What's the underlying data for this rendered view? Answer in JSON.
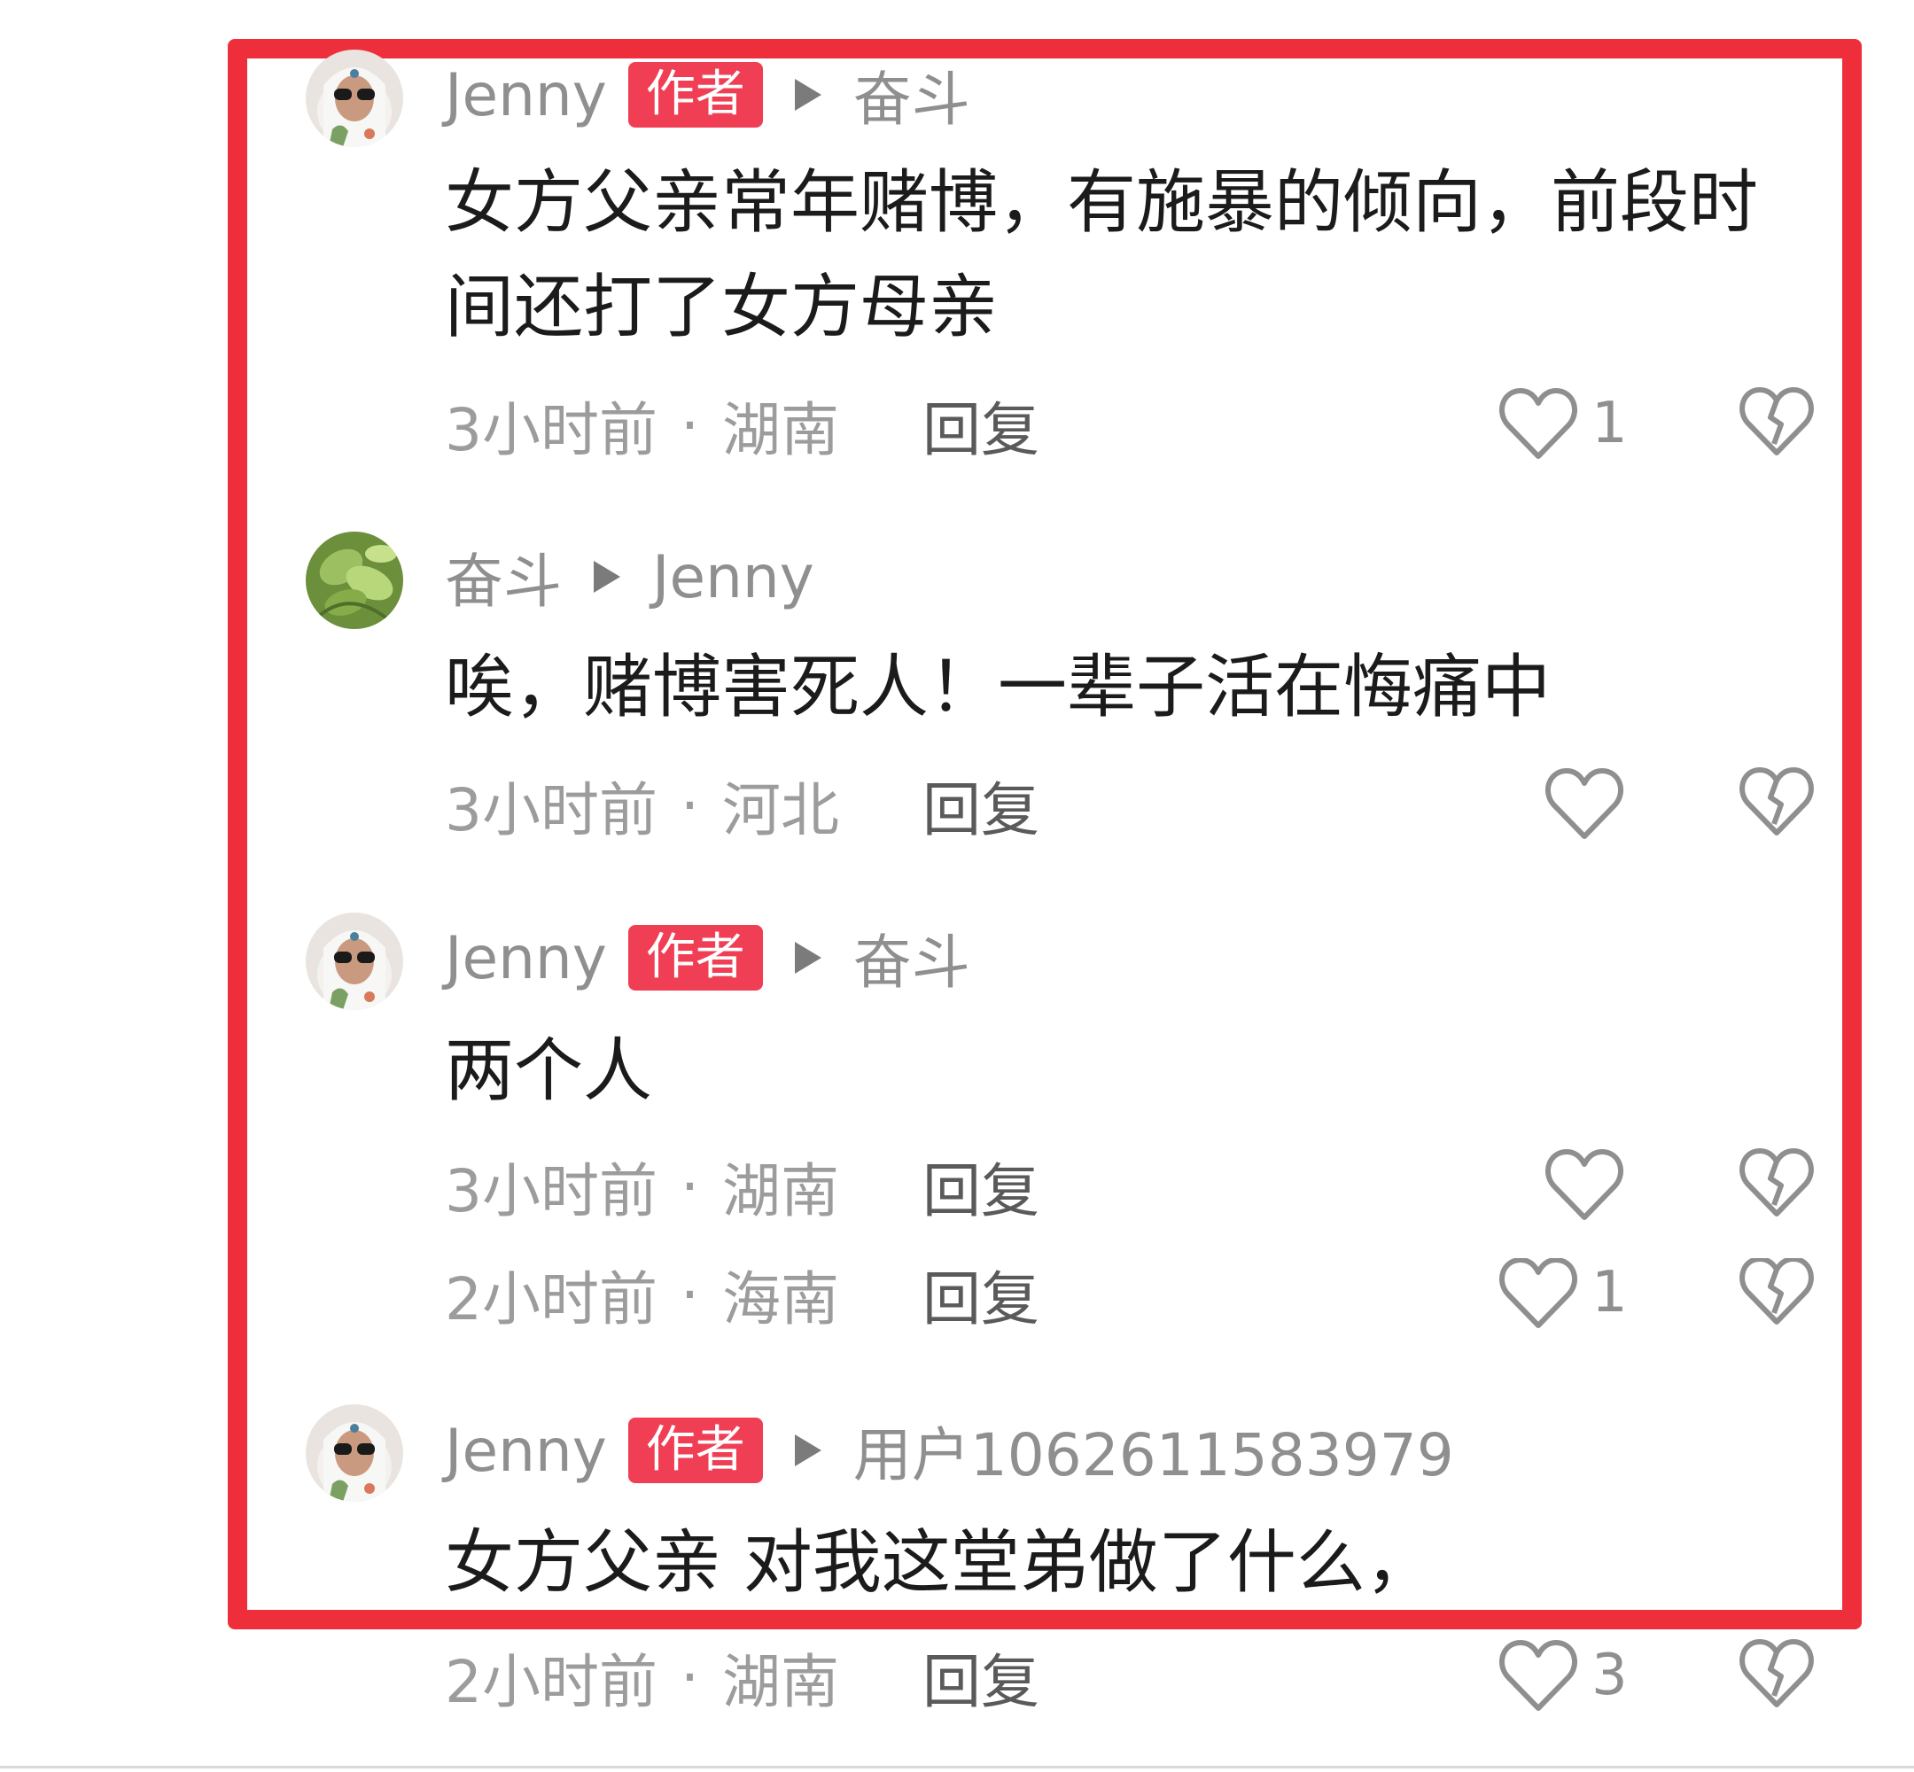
{
  "comments": [
    {
      "author": "Jenny",
      "badge": "作者",
      "reply_to": "奋斗",
      "text_lines": [
        "女方父亲常年赌博，有施暴的倾向，前段时",
        "间还打了女方母亲"
      ],
      "time": "3小时前",
      "location": "湖南",
      "reply_label": "回复",
      "likes": "1",
      "avatar": "avatar-sunglasses"
    },
    {
      "author": "奋斗",
      "reply_to": "Jenny",
      "text_lines": [
        "唉，赌博害死人！一辈子活在悔痛中"
      ],
      "time": "3小时前",
      "location": "河北",
      "reply_label": "回复",
      "avatar": "avatar-leaves"
    },
    {
      "author": "Jenny",
      "badge": "作者",
      "reply_to": "奋斗",
      "text_lines": [
        "两个人"
      ],
      "time": "3小时前",
      "location": "湖南",
      "reply_label": "回复",
      "avatar": "avatar-sunglasses"
    },
    {
      "time": "2小时前",
      "location": "海南",
      "reply_label": "回复",
      "likes": "1"
    },
    {
      "author": "Jenny",
      "badge": "作者",
      "reply_to": "用户1062611583979",
      "text_lines": [
        "女方父亲 对我这堂弟做了什么，"
      ],
      "time": "2小时前",
      "location": "湖南",
      "reply_label": "回复",
      "likes": "3",
      "avatar": "avatar-sunglasses"
    }
  ],
  "separator": "·",
  "icons": {
    "like": "heart-outline-icon",
    "dislike": "broken-heart-icon",
    "reply_arrow": "play-arrow-icon"
  },
  "colors": {
    "highlight_border": "#ee2e3a",
    "badge_bg": "#f03e55",
    "meta_text": "#9c9c9c"
  }
}
